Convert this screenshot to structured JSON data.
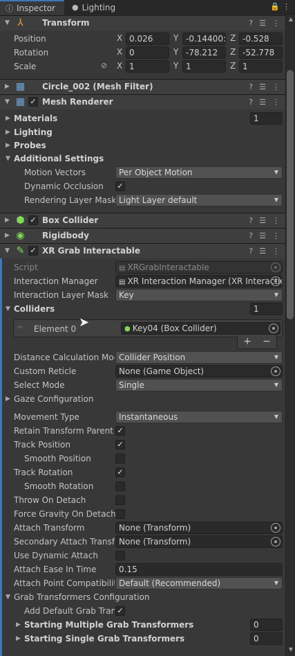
{
  "tabs": [
    {
      "label": "Inspector",
      "icon": "info-icon",
      "active": true
    },
    {
      "label": "Lighting",
      "icon": "light-bulb-icon",
      "active": false
    }
  ],
  "transform": {
    "title": "Transform",
    "position": {
      "label": "Position",
      "x": "0.026",
      "y": "-0.14400:",
      "z": "-0.528"
    },
    "rotation": {
      "label": "Rotation",
      "x": "0",
      "y": "-78.212",
      "z": "-52.778"
    },
    "scale": {
      "label": "Scale",
      "x": "1",
      "y": "1",
      "z": "1"
    },
    "axis": {
      "x": "X",
      "y": "Y",
      "z": "Z"
    }
  },
  "mesh_filter": {
    "title": "Circle_002 (Mesh Filter)"
  },
  "mesh_renderer": {
    "title": "Mesh Renderer",
    "materials": {
      "label": "Materials",
      "count": "1"
    },
    "lighting": "Lighting",
    "probes": "Probes",
    "additional": "Additional Settings",
    "motion_vectors": {
      "label": "Motion Vectors",
      "value": "Per Object Motion"
    },
    "dynamic_occlusion": {
      "label": "Dynamic Occlusion",
      "checked": true
    },
    "rendering_layer_mask": {
      "label": "Rendering Layer Mask",
      "value": "Light Layer default"
    }
  },
  "box_collider": {
    "title": "Box Collider"
  },
  "rigidbody": {
    "title": "Rigidbody"
  },
  "xr": {
    "title": "XR Grab Interactable",
    "script": {
      "label": "Script",
      "value": "XRGrabInteractable"
    },
    "interaction_manager": {
      "label": "Interaction Manager",
      "value": "XR Interaction Manager (XR Interactio"
    },
    "interaction_layer_mask": {
      "label": "Interaction Layer Mask",
      "value": "Key"
    },
    "colliders": {
      "label": "Colliders",
      "count": "1",
      "element_label": "Element 0",
      "element_value": "Key04 (Box Collider)"
    },
    "list_add": "+",
    "list_remove": "−",
    "distance_calc": {
      "label": "Distance Calculation Mod",
      "value": "Collider Position"
    },
    "custom_reticle": {
      "label": "Custom Reticle",
      "value": "None (Game Object)"
    },
    "select_mode": {
      "label": "Select Mode",
      "value": "Single"
    },
    "gaze_config": "Gaze Configuration",
    "movement_type": {
      "label": "Movement Type",
      "value": "Instantaneous"
    },
    "retain_transform_parent": {
      "label": "Retain Transform Parent",
      "checked": true
    },
    "track_position": {
      "label": "Track Position",
      "checked": true
    },
    "smooth_position": {
      "label": "Smooth Position",
      "checked": false
    },
    "track_rotation": {
      "label": "Track Rotation",
      "checked": true
    },
    "smooth_rotation": {
      "label": "Smooth Rotation",
      "checked": false
    },
    "throw_on_detach": {
      "label": "Throw On Detach",
      "checked": false
    },
    "force_gravity": {
      "label": "Force Gravity On Detach",
      "checked": false
    },
    "attach_transform": {
      "label": "Attach Transform",
      "value": "None (Transform)"
    },
    "secondary_attach": {
      "label": "Secondary Attach Transfo",
      "value": "None (Transform)"
    },
    "use_dynamic_attach": {
      "label": "Use Dynamic Attach",
      "checked": false
    },
    "attach_ease": {
      "label": "Attach Ease In Time",
      "value": "0.15"
    },
    "attach_point_compat": {
      "label": "Attach Point Compatibility",
      "value": "Default (Recommended)"
    },
    "grab_transformers": "Grab Transformers Configuration",
    "add_default_grab": {
      "label": "Add Default Grab Trans",
      "checked": true
    },
    "starting_multiple": {
      "label": "Starting Multiple Grab Transformers",
      "count": "0"
    },
    "starting_single": {
      "label": "Starting Single Grab Transformers",
      "count": "0"
    }
  },
  "check_glyph": "✓",
  "colors": {
    "accent": "#3a79bb",
    "panel": "#383838",
    "header": "#3e3e3e"
  }
}
